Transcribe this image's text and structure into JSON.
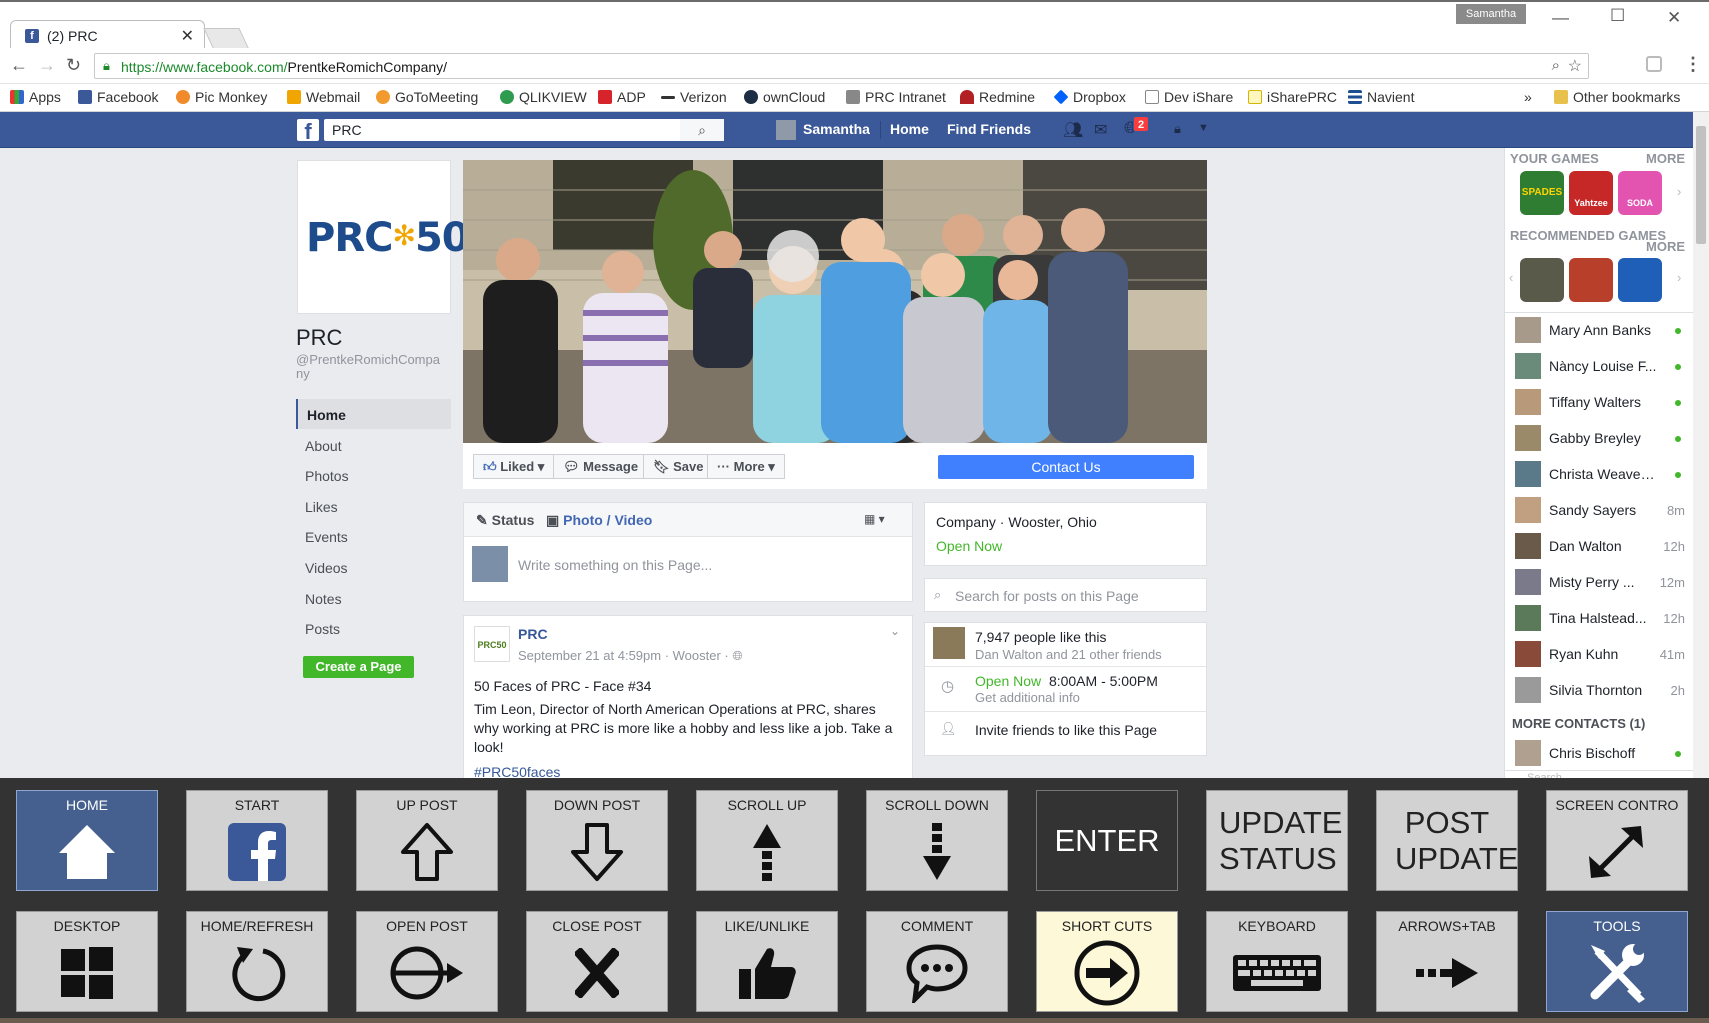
{
  "browser": {
    "tab_title": "(2) PRC",
    "tab_favicon": "facebook-icon",
    "window_user": "Samantha",
    "url_host": "https://www.facebook.com/",
    "url_path": "PrentkeRomichCompany/",
    "bookmarks": [
      "Apps",
      "Facebook",
      "Pic Monkey",
      "Webmail",
      "GoToMeeting",
      "QLIKVIEW",
      "ADP",
      "Verizon",
      "ownCloud",
      "PRC Intranet",
      "Redmine",
      "Dropbox",
      "Dev iShare",
      "iSharePRC",
      "Navient"
    ],
    "more_bookmarks": "»",
    "other_bookmarks": "Other bookmarks"
  },
  "fb": {
    "search_value": "PRC",
    "nav_user": "Samantha",
    "nav_home": "Home",
    "nav_find_friends": "Find Friends",
    "notif_count": "2",
    "page_logo": "PRC",
    "page_logo_num": "50",
    "page_name": "PRC",
    "page_handle": "@PrentkeRomichCompany",
    "left_nav": [
      "Home",
      "About",
      "Photos",
      "Likes",
      "Events",
      "Videos",
      "Notes",
      "Posts"
    ],
    "create_page": "Create a Page",
    "actions": {
      "liked": "Liked",
      "message": "Message",
      "save": "Save",
      "more": "More",
      "contact": "Contact Us"
    },
    "composer": {
      "status": "Status",
      "photo": "Photo / Video",
      "placeholder": "Write something on this Page..."
    },
    "post": {
      "author": "PRC",
      "avatar_text": "PRC50",
      "meta": "September 21 at 4:59pm · Wooster ·",
      "title": "50 Faces of PRC - Face #34",
      "body": "Tim Leon, Director of North American Operations at PRC, shares why working at PRC is more like a hobby and less like a job. Take a look!",
      "hashtag": "#PRC50faces"
    },
    "about": {
      "category": "Company · Wooster, Ohio",
      "open": "Open Now"
    },
    "search_posts_placeholder": "Search for posts on this Page",
    "likes": {
      "count": "7,947 people like this",
      "friends": "Dan Walton and 21 other friends",
      "hours_open": "Open Now",
      "hours": "8:00AM - 5:00PM",
      "more_info": "Get additional info",
      "invite": "Invite friends to like this Page"
    },
    "right": {
      "your_games": "YOUR GAMES",
      "more": "MORE",
      "recommended": "RECOMMENDED GAMES",
      "games": [
        "SPADES",
        "Yahtzee",
        "SODA"
      ],
      "contacts": [
        {
          "name": "Mary Ann Banks",
          "status": ""
        },
        {
          "name": "Nàncy Louise F...",
          "status": ""
        },
        {
          "name": "Tiffany Walters",
          "status": ""
        },
        {
          "name": "Gabby Breyley",
          "status": ""
        },
        {
          "name": "Christa Weaver ...",
          "status": ""
        },
        {
          "name": "Sandy Sayers",
          "status": "8m"
        },
        {
          "name": "Dan Walton",
          "status": "12h"
        },
        {
          "name": "Misty Perry ...",
          "status": "12m"
        },
        {
          "name": "Tina Halstead...",
          "status": "12h"
        },
        {
          "name": "Ryan Kuhn",
          "status": "41m"
        },
        {
          "name": "Silvia Thornton",
          "status": "2h"
        }
      ],
      "more_contacts": "MORE CONTACTS (1)",
      "extra_contact": "Chris Bischoff",
      "chat_search": "Search"
    }
  },
  "grid": {
    "row1": [
      {
        "label": "HOME",
        "icon": "home-icon"
      },
      {
        "label": "START",
        "icon": "facebook-icon"
      },
      {
        "label": "UP POST",
        "icon": "up-arrow-icon"
      },
      {
        "label": "DOWN POST",
        "icon": "down-arrow-icon"
      },
      {
        "label": "SCROLL UP",
        "icon": "scroll-up-icon"
      },
      {
        "label": "SCROLL DOWN",
        "icon": "scroll-down-icon"
      },
      {
        "label": "ENTER",
        "icon": ""
      },
      {
        "label": "UPDATE STATUS",
        "icon": ""
      },
      {
        "label": "POST UPDATE",
        "icon": ""
      },
      {
        "label": "SCREEN CONTRO",
        "icon": "resize-icon"
      }
    ],
    "row2": [
      {
        "label": "DESKTOP",
        "icon": "windows-icon"
      },
      {
        "label": "HOME/REFRESH",
        "icon": "refresh-icon"
      },
      {
        "label": "OPEN POST",
        "icon": "open-post-icon"
      },
      {
        "label": "CLOSE POST",
        "icon": "close-icon"
      },
      {
        "label": "LIKE/UNLIKE",
        "icon": "thumbs-up-icon"
      },
      {
        "label": "COMMENT",
        "icon": "comment-icon"
      },
      {
        "label": "SHORT CUTS",
        "icon": "arrow-circle-icon"
      },
      {
        "label": "KEYBOARD",
        "icon": "keyboard-icon"
      },
      {
        "label": "ARROWS+TAB",
        "icon": "arrow-right-icon"
      },
      {
        "label": "TOOLS",
        "icon": "tools-icon"
      }
    ]
  },
  "colors": {
    "fb_blue": "#3b5998",
    "grid_bg": "#333333",
    "cell_gray": "#d2d2d2",
    "cell_blue": "#45608f",
    "cream": "#fdf8d8"
  }
}
